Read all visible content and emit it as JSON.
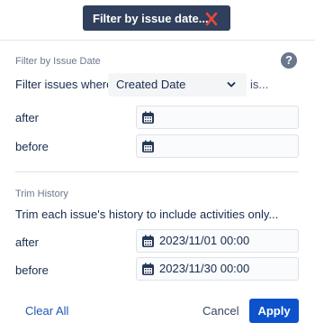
{
  "chip": {
    "label": "Filter by issue date...",
    "close_icon": "close-x-icon",
    "close_color": "#e5493a"
  },
  "issue_date": {
    "title": "Filter by Issue Date",
    "help_icon": "question-circle-icon",
    "prefix": "Filter issues where",
    "field": {
      "selected": "Created Date",
      "icon": "chevron-down-icon"
    },
    "suffix": "is...",
    "after_label": "after",
    "after_value": "",
    "before_label": "before",
    "before_value": ""
  },
  "trim_history": {
    "title": "Trim History",
    "description": "Trim each issue's history to include activities only...",
    "after_label": "after",
    "after_value": "2023/11/01 00:00",
    "before_label": "before",
    "before_value": "2023/11/30 00:00"
  },
  "footer": {
    "clear_label": "Clear All",
    "cancel_label": "Cancel",
    "apply_label": "Apply"
  },
  "colors": {
    "primary": "#0c52cc",
    "chip_bg": "#2f3f5c",
    "link": "#1e56b6"
  }
}
